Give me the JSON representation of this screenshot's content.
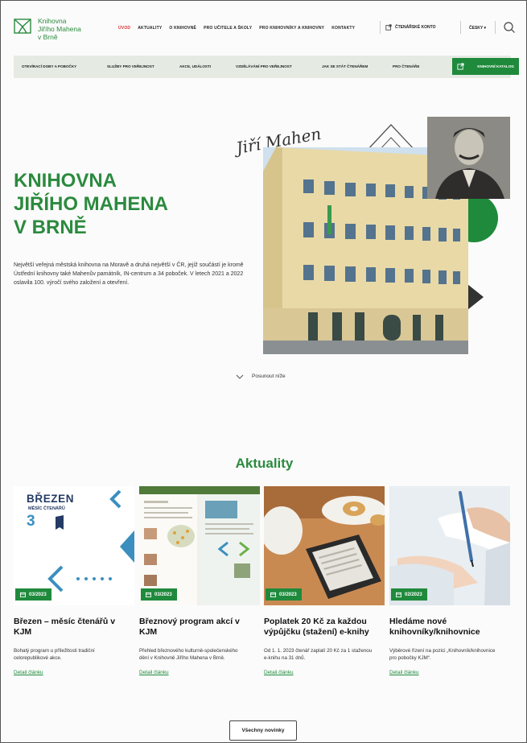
{
  "logo": {
    "lines": [
      "Knihovna",
      "Jiřího Mahena",
      "v Brně"
    ]
  },
  "nav": {
    "items": [
      "ÚVOD",
      "AKTUALITY",
      "O KNIHOVNĚ",
      "PRO UČITELE A ŠKOLY",
      "PRO KNIHOVNÍKY A KNIHOVNY",
      "KONTAKTY"
    ],
    "active_index": 0,
    "account": "ČTENÁŘSKÉ KONTO",
    "language": "ČESKY ▾"
  },
  "subnav": {
    "items": [
      "OTEVÍRACÍ DOBY A POBOČKY",
      "SLUŽBY PRO VEŘEJNOST",
      "AKCE, UDÁLOSTI",
      "VZDĚLÁVÁNÍ PRO VEŘEJNOST",
      "JAK SE STÁT ČTENÁŘEM",
      "PRO ČTENÁŘE"
    ],
    "catalog": "KNIHOVNÍ KATALOG"
  },
  "hero": {
    "title_lines": [
      "KNIHOVNA",
      "JIŘÍHO MAHENA",
      "V BRNĚ"
    ],
    "description": "Největší veřejná městská knihovna na Moravě a druhá největší v ČR, jejíž součástí je kromě Ústřední knihovny také Mahenův památník, IN-centrum a 34 poboček. V letech 2021 a 2022 oslavila 100. výročí svého založení a otevření.",
    "signature": "Jiří Mahen",
    "scroll_hint": "Posunout níže"
  },
  "news": {
    "heading": "Aktuality",
    "cards": [
      {
        "date": "03/2023",
        "title": "Březen – měsíc čtenářů v KJM",
        "text": "Bohatý program u příležitosti tradiční celorepublikové akce.",
        "link": "Detail článku",
        "promo_line1": "BŘEZEN",
        "promo_line2": "MĚSÍC ČTENÁŘŮ",
        "promo_number": "3"
      },
      {
        "date": "03/2023",
        "title": "Březnový program akcí v KJM",
        "text": "Přehled březnového kulturně-společenského dění v Knihovně Jiřího Mahena v Brně.",
        "link": "Detail článku"
      },
      {
        "date": "03/2023",
        "title": "Poplatek 20 Kč za každou výpůjčku (stažení) e-knihy",
        "text": "Od 1. 1. 2023 čtenář zaplatí 20 Kč za 1 staženou e-knihu na 31 dnů.",
        "link": "Detail článku"
      },
      {
        "date": "02/2023",
        "title": "Hledáme nové knihovníky/knihovnice",
        "text": "Výběrové řízení na pozici „Knihovník/knihovnice pro pobočky KJM“.",
        "link": "Detail článku"
      }
    ],
    "all_button": "Všechny novinky"
  },
  "colors": {
    "brand": "#2b8a3e",
    "button": "#1f8a3c",
    "active_nav": "#dd3333"
  }
}
